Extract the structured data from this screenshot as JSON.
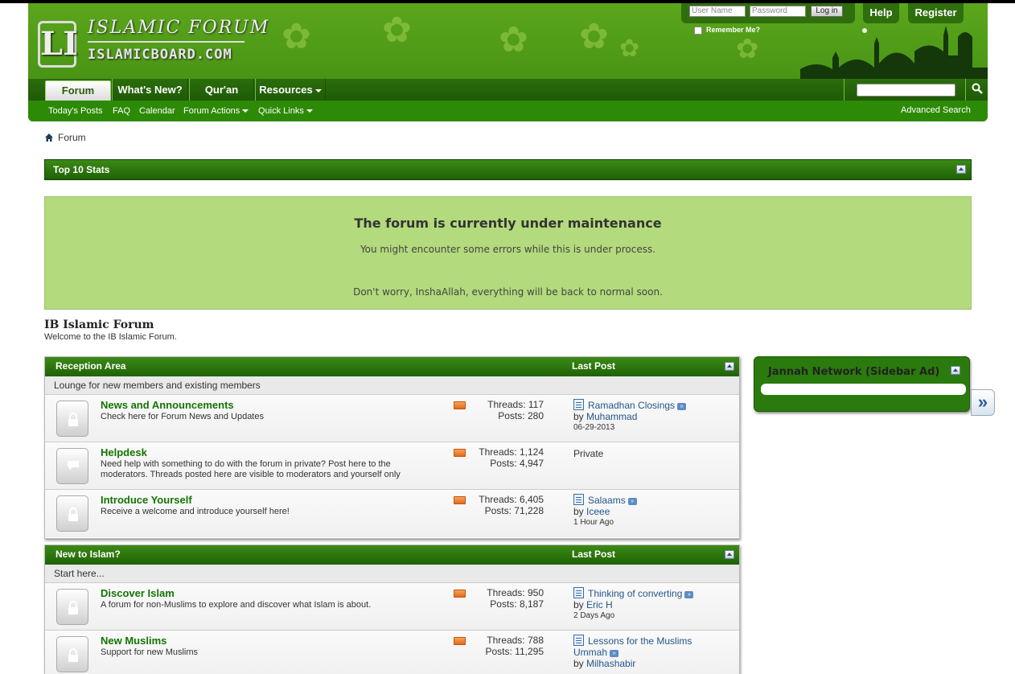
{
  "header": {
    "logo_mark": "LI",
    "logo_title": "ISLAMIC FORUM",
    "logo_sub": "ISLAMICBOARD.COM",
    "login": {
      "username_placeholder": "User Name",
      "password_placeholder": "Password",
      "button_label": "Log in",
      "remember_label": "Remember Me?"
    },
    "help_label": "Help",
    "register_label": "Register"
  },
  "navbar": {
    "tabs": [
      {
        "label": "Forum",
        "selected": true
      },
      {
        "label": "What's New?"
      },
      {
        "label": "Qur'an"
      },
      {
        "label": "Resources"
      }
    ]
  },
  "subnav": {
    "links": [
      "Today's Posts",
      "FAQ",
      "Calendar",
      "Forum Actions",
      "Quick Links"
    ],
    "advanced_search": "Advanced Search"
  },
  "breadcrumb": {
    "label": "Forum"
  },
  "top_stats": {
    "label": "Top 10 Stats"
  },
  "notice": {
    "title": "The forum is currently under maintenance",
    "line1": "You might encounter some errors while this is under process.",
    "line2": "Don't worry, InshaAllah, everything will be back to normal soon."
  },
  "forum": {
    "title": "IB Islamic Forum",
    "description": "Welcome to the IB Islamic Forum."
  },
  "categories": [
    {
      "name": "Reception Area",
      "last_post_label": "Last Post",
      "description": "Lounge for new members and existing members",
      "forums": [
        {
          "name": "News and Announcements",
          "description": "Check here for Forum News and Updates",
          "threads": "Threads: 117",
          "posts": "Posts: 280",
          "last_title": "Ramadhan Closings",
          "last_by": "by ",
          "last_user": "Muhammad",
          "last_date": "06-29-2013"
        },
        {
          "name": "Helpdesk",
          "description": "Need help with something to do with the forum in private? Post here to the moderators. Threads posted here are visible to moderators and yourself only",
          "threads": "Threads: 1,124",
          "posts": "Posts: 4,947",
          "private": "Private"
        },
        {
          "name": "Introduce Yourself",
          "description": "Receive a welcome and introduce yourself here!",
          "threads": "Threads: 6,405",
          "posts": "Posts: 71,228",
          "last_title": "Salaams",
          "last_by": "by ",
          "last_user": "Iceee",
          "last_date": "1 Hour Ago"
        }
      ]
    },
    {
      "name": "New to Islam?",
      "last_post_label": "Last Post",
      "description": "Start here...",
      "forums": [
        {
          "name": "Discover Islam",
          "description": "A forum for non-Muslims to explore and discover what Islam is about.",
          "threads": "Threads: 950",
          "posts": "Posts: 8,187",
          "last_title": "Thinking of converting",
          "last_by": "by ",
          "last_user": "Eric H",
          "last_date": "2 Days Ago"
        },
        {
          "name": "New Muslims",
          "description": "Support for new Muslims",
          "threads": "Threads: 788",
          "posts": "Posts: 11,295",
          "last_title": "Lessons for the Muslims",
          "last_title2": "Ummah",
          "last_by": "by ",
          "last_user": "Milhashabir"
        }
      ]
    }
  ],
  "sidebar": {
    "title": "Jannah Network (Sidebar Ad)",
    "toggle": "»"
  },
  "colors": {
    "brand_green": "#3f8a10",
    "nav_green": "#2d8a06",
    "notice_bg": "#b3da7c",
    "forum_link": "#157400"
  }
}
